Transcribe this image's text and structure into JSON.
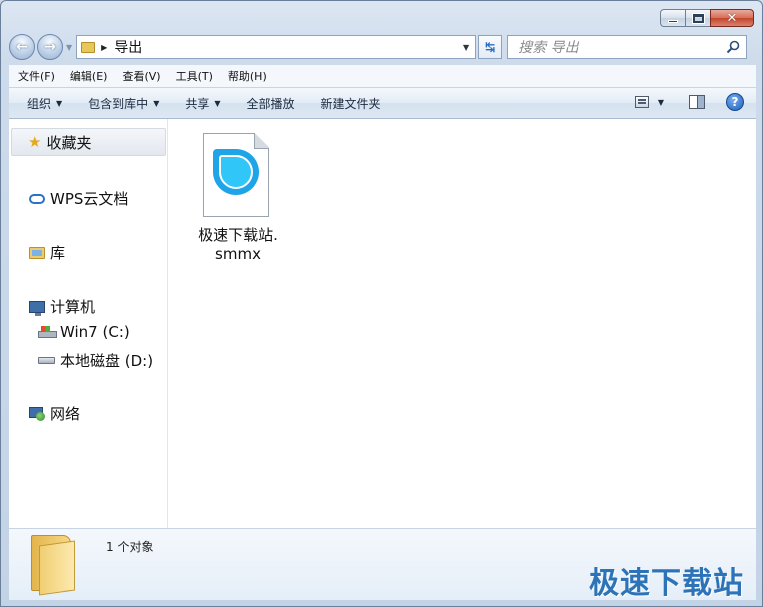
{
  "window": {
    "caption_buttons": {
      "minimize": "minimize-icon",
      "maximize": "maximize-icon",
      "close": "close-icon"
    }
  },
  "nav": {
    "back_icon": "arrow-left-icon",
    "forward_icon": "arrow-right-icon",
    "address": {
      "current_folder": "导出"
    },
    "search": {
      "placeholder": "搜索 导出"
    }
  },
  "menu": {
    "items": [
      "文件(F)",
      "编辑(E)",
      "查看(V)",
      "工具(T)",
      "帮助(H)"
    ]
  },
  "toolbar": {
    "organize": "组织",
    "include_library": "包含到库中",
    "share": "共享",
    "play_all": "全部播放",
    "new_folder": "新建文件夹"
  },
  "sidebar": {
    "favorites": "收藏夹",
    "wps_cloud": "WPS云文档",
    "libraries": "库",
    "computer": "计算机",
    "drive_c": "Win7 (C:)",
    "drive_d": "本地磁盘 (D:)",
    "network": "网络"
  },
  "content": {
    "files": [
      {
        "name_line1": "极速下载站.",
        "name_line2": "smmx",
        "icon": "simplemind-file-icon"
      }
    ]
  },
  "details": {
    "status": "1 个对象"
  },
  "watermark": {
    "text": "极速下载站"
  },
  "colors": {
    "accent": "#2c73b8",
    "file_icon": "#1fa4e8"
  }
}
